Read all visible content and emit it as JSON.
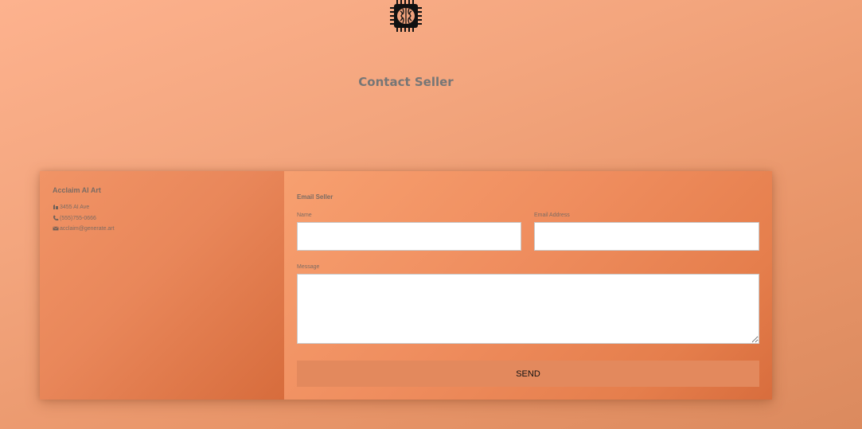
{
  "header": {
    "logo_icon": "brain-chip-icon",
    "title": "Contact Seller"
  },
  "seller_info": {
    "name": "Acclaim AI Art",
    "address": "3455 AI Ave",
    "address_icon": "building-icon",
    "phone": "(555)755-0666",
    "phone_icon": "phone-icon",
    "email": "acclaim@generate.art",
    "email_icon": "envelope-icon"
  },
  "email_form": {
    "title": "Email Seller",
    "name_label": "Name",
    "name_value": "",
    "email_label": "Email Address",
    "email_value": "",
    "message_label": "Message",
    "message_value": "",
    "send_label": "SEND"
  },
  "colors": {
    "background_start": "#fdb28e",
    "background_end": "#db8a5e",
    "info_panel": "#e9875a",
    "form_panel": "#ef8d5e",
    "send_button": "#e3895d"
  }
}
